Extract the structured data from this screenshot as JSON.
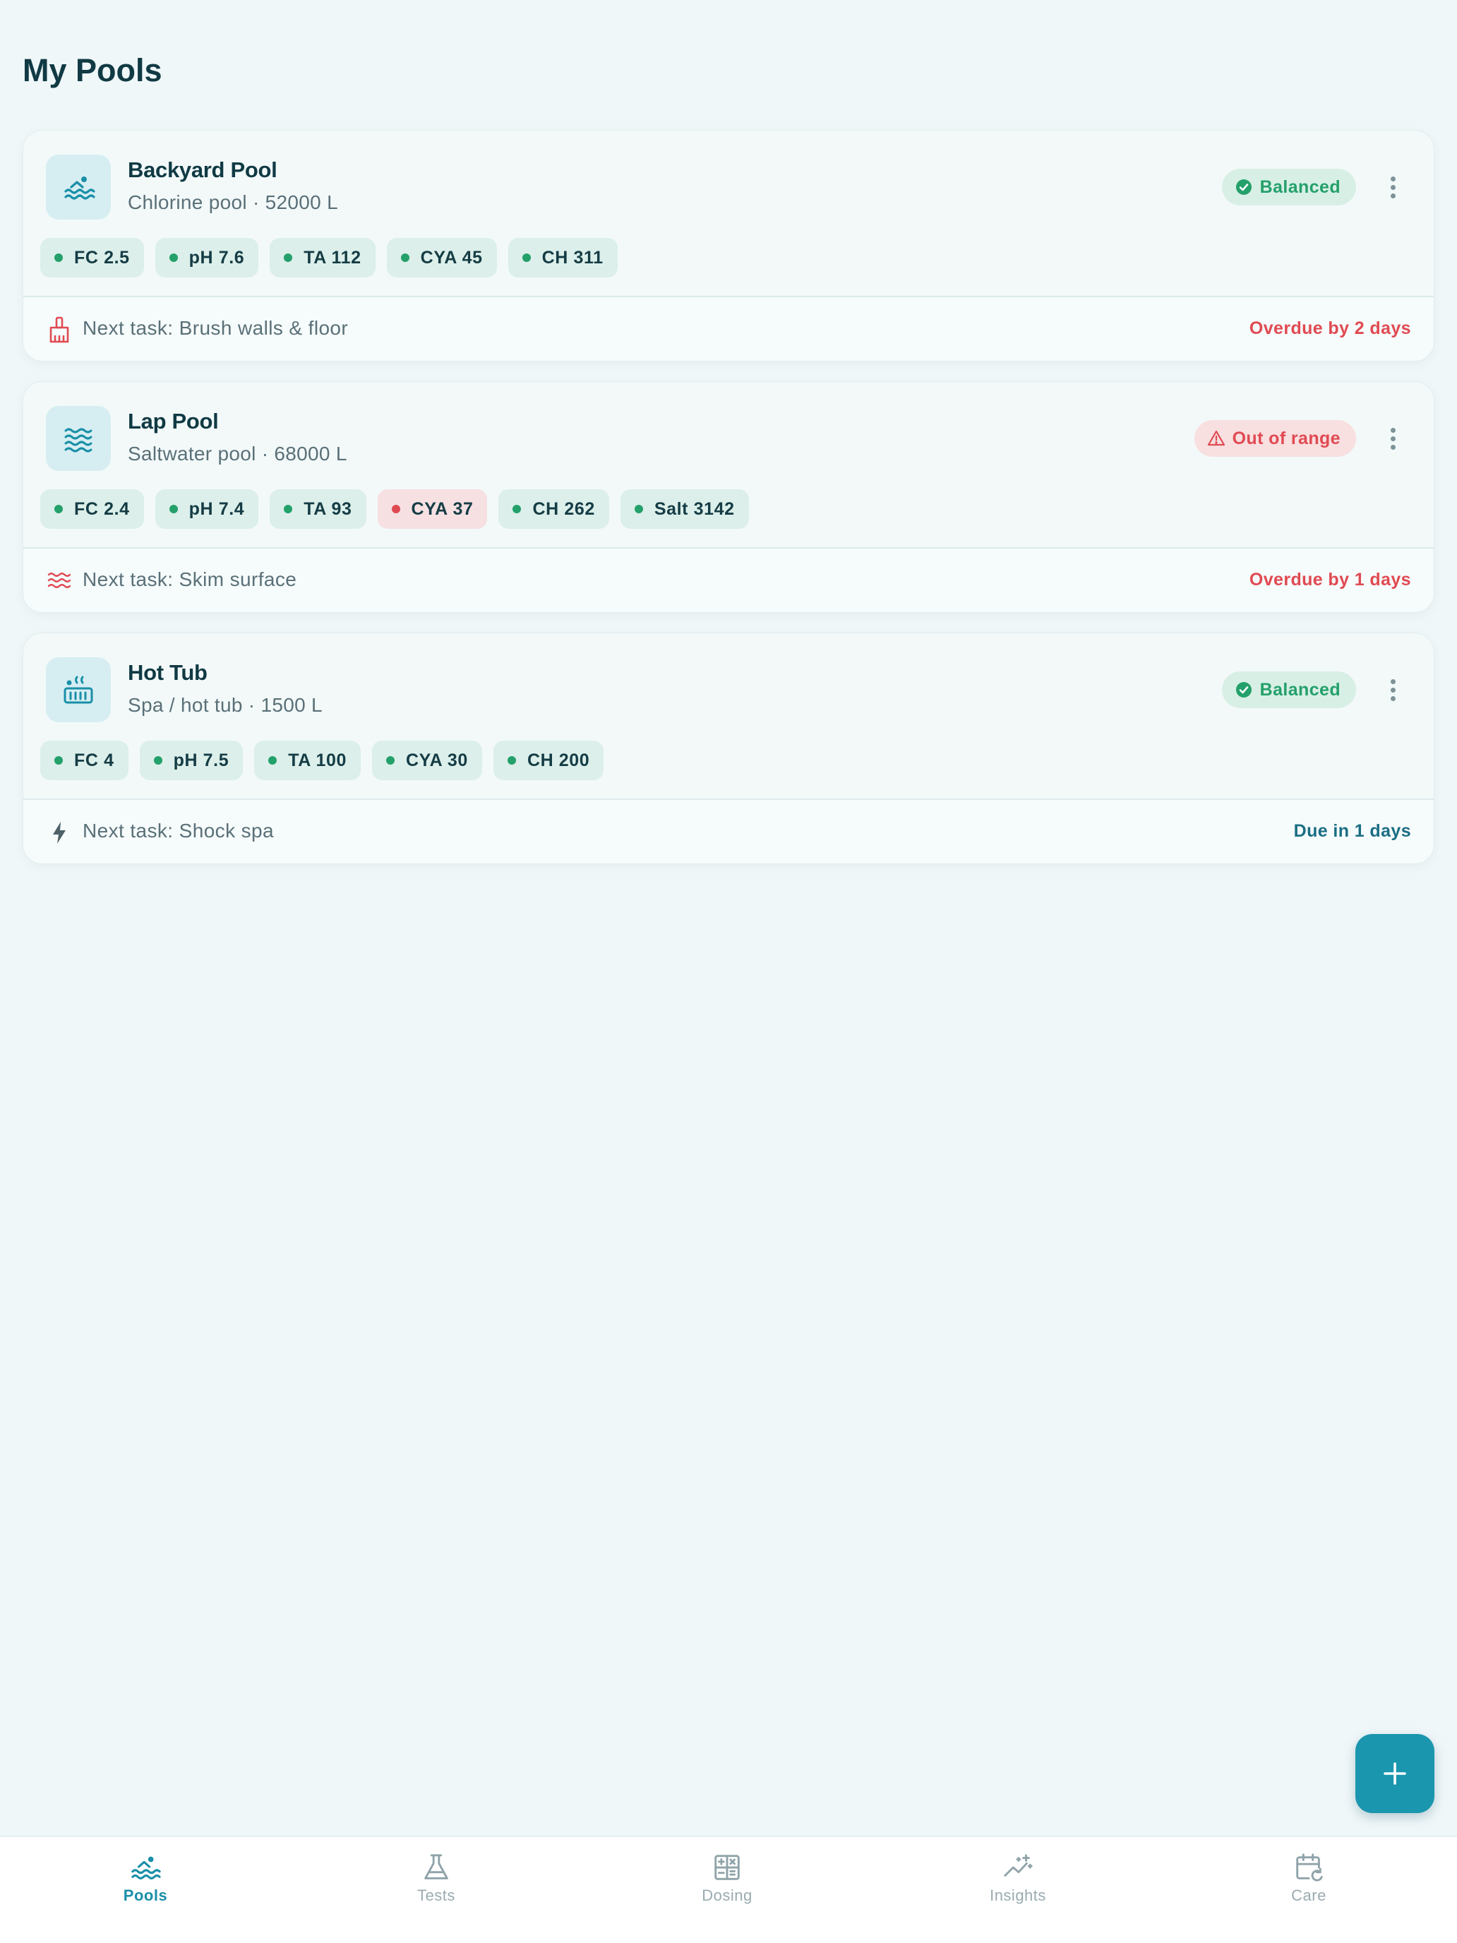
{
  "page": {
    "title": "My Pools"
  },
  "pools": [
    {
      "name": "Backyard Pool",
      "subtitle": "Chlorine pool · 52000 L",
      "icon": "swimmer-icon",
      "status": {
        "label": "Balanced",
        "kind": "ok"
      },
      "chips": [
        {
          "label": "FC 2.5",
          "state": "ok"
        },
        {
          "label": "pH 7.6",
          "state": "ok"
        },
        {
          "label": "TA 112",
          "state": "ok"
        },
        {
          "label": "CYA 45",
          "state": "ok"
        },
        {
          "label": "CH 311",
          "state": "ok"
        }
      ],
      "task": {
        "icon": "brush-icon",
        "label": "Next task: Brush walls & floor",
        "due": "Overdue by 2 days",
        "due_kind": "overdue"
      }
    },
    {
      "name": "Lap Pool",
      "subtitle": "Saltwater pool · 68000 L",
      "icon": "waves-icon",
      "status": {
        "label": "Out of range",
        "kind": "bad"
      },
      "chips": [
        {
          "label": "FC 2.4",
          "state": "ok"
        },
        {
          "label": "pH 7.4",
          "state": "ok"
        },
        {
          "label": "TA 93",
          "state": "ok"
        },
        {
          "label": "CYA 37",
          "state": "bad"
        },
        {
          "label": "CH 262",
          "state": "ok"
        },
        {
          "label": "Salt 3142",
          "state": "ok"
        }
      ],
      "task": {
        "icon": "waves-icon",
        "label": "Next task: Skim surface",
        "due": "Overdue by 1 days",
        "due_kind": "overdue"
      }
    },
    {
      "name": "Hot Tub",
      "subtitle": "Spa / hot tub · 1500 L",
      "icon": "hot-tub-icon",
      "status": {
        "label": "Balanced",
        "kind": "ok"
      },
      "chips": [
        {
          "label": "FC 4",
          "state": "ok"
        },
        {
          "label": "pH 7.5",
          "state": "ok"
        },
        {
          "label": "TA 100",
          "state": "ok"
        },
        {
          "label": "CYA 30",
          "state": "ok"
        },
        {
          "label": "CH 200",
          "state": "ok"
        }
      ],
      "task": {
        "icon": "bolt-icon",
        "label": "Next task: Shock spa",
        "due": "Due in 1 days",
        "due_kind": "soon"
      }
    }
  ],
  "nav": {
    "items": [
      {
        "label": "Pools",
        "icon": "swimmer-icon",
        "active": true
      },
      {
        "label": "Tests",
        "icon": "flask-icon",
        "active": false
      },
      {
        "label": "Dosing",
        "icon": "calculator-icon",
        "active": false
      },
      {
        "label": "Insights",
        "icon": "sparkle-chart-icon",
        "active": false
      },
      {
        "label": "Care",
        "icon": "calendar-refresh-icon",
        "active": false
      }
    ]
  },
  "colors": {
    "accent": "#1a96ae",
    "ok": "#24a06b",
    "bad": "#e04a52",
    "title": "#103a44"
  }
}
